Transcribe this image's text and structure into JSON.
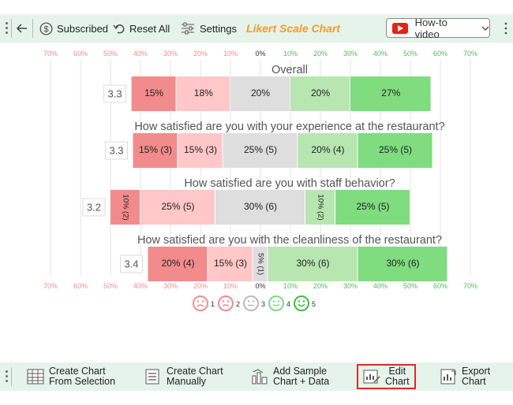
{
  "toolbar": {
    "subscribed": "Subscribed",
    "reset_all": "Reset All",
    "settings": "Settings",
    "title": "Likert Scale Chart",
    "howto": "How-to video"
  },
  "bottom": {
    "create_from_selection": [
      "Create Chart",
      "From Selection"
    ],
    "create_manually": [
      "Create Chart",
      "Manually"
    ],
    "add_sample": [
      "Add Sample",
      "Chart + Data"
    ],
    "edit_chart": [
      "Edit",
      "Chart"
    ],
    "export_chart": [
      "Export",
      "Chart"
    ]
  },
  "colors": {
    "toolbar_bg": "#e6f3ea",
    "title": "#f39a2a",
    "neg_axis": "#f08c8c",
    "pos_axis": "#57b857",
    "s1": "#f28c8c",
    "s2": "#ffc7c7",
    "s3": "#dedede",
    "s4": "#b7e6b1",
    "s5": "#7fdc7f",
    "accent_red": "#d72b2b"
  },
  "chart_data": {
    "type": "bar",
    "subtype": "diverging-stacked",
    "axis_ticks": [
      "70%",
      "60%",
      "50%",
      "40%",
      "30%",
      "20%",
      "10%",
      "0%",
      "10%",
      "20%",
      "30%",
      "40%",
      "50%",
      "60%",
      "70%"
    ],
    "xlim": [
      -70,
      70
    ],
    "grid": true,
    "legend": {
      "placement": "bottom",
      "entries": [
        "1",
        "2",
        "3",
        "4",
        "5"
      ]
    },
    "questions": [
      {
        "title": "Overall",
        "mean": "3.3",
        "values": [
          15,
          18,
          20,
          20,
          27
        ],
        "labels": [
          "15%",
          "18%",
          "20%",
          "20%",
          "27%"
        ]
      },
      {
        "title": "How satisfied are you with your experience at the restaurant?",
        "mean": "3.3",
        "values": [
          15,
          15,
          25,
          20,
          25
        ],
        "labels": [
          "15% (3)",
          "15% (3)",
          "25% (5)",
          "20% (4)",
          "25% (5)"
        ]
      },
      {
        "title": "How satisfied are you with staff behavior?",
        "mean": "3.2",
        "values": [
          10,
          25,
          30,
          10,
          25
        ],
        "labels": [
          "10% (2)",
          "25% (5)",
          "30% (6)",
          "10% (2)",
          "25% (5)"
        ]
      },
      {
        "title": "How satisfied are you with the cleanliness of the restaurant?",
        "mean": "3.4",
        "values": [
          0,
          20,
          15,
          5,
          30,
          30
        ],
        "segments_note": "",
        "values5": [
          20,
          15,
          5,
          30,
          30
        ],
        "labels": [
          "20% (4)",
          "15% (3)",
          "5% (1)",
          "30% (6)",
          "30% (6)"
        ]
      }
    ]
  }
}
